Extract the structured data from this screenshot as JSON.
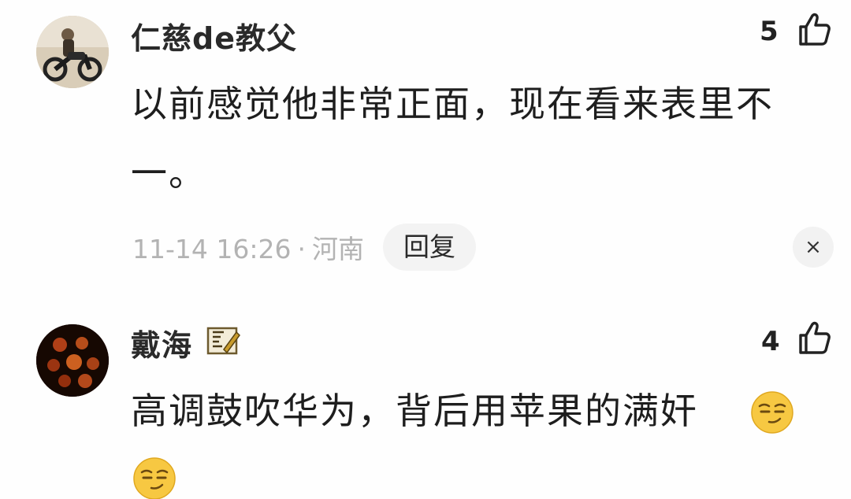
{
  "comments": [
    {
      "username": "仁慈de教父",
      "likes": "5",
      "text": "以前感觉他非常正面，现在看来表里不一。",
      "timestamp": "11-14 16:26",
      "separator": "·",
      "location": "河南",
      "reply_label": "回复",
      "dismiss_icon": "×",
      "avatar_icon": "motorcycle-rider-avatar",
      "like_icon": "thumbs-up-icon"
    },
    {
      "username": "戴海",
      "badge_icon": "level-badge-icon",
      "likes": "4",
      "text": "高调鼓吹华为，背后用苹果的满奸",
      "emoji_icon": "smirk-emoji",
      "avatar_icon": "dark-photo-avatar",
      "like_icon": "thumbs-up-icon"
    }
  ],
  "colors": {
    "text_primary": "#1e1e1e",
    "text_secondary": "#b3b3b3",
    "pill_bg": "#f3f3f3",
    "emoji_yellow": "#f7c842"
  }
}
